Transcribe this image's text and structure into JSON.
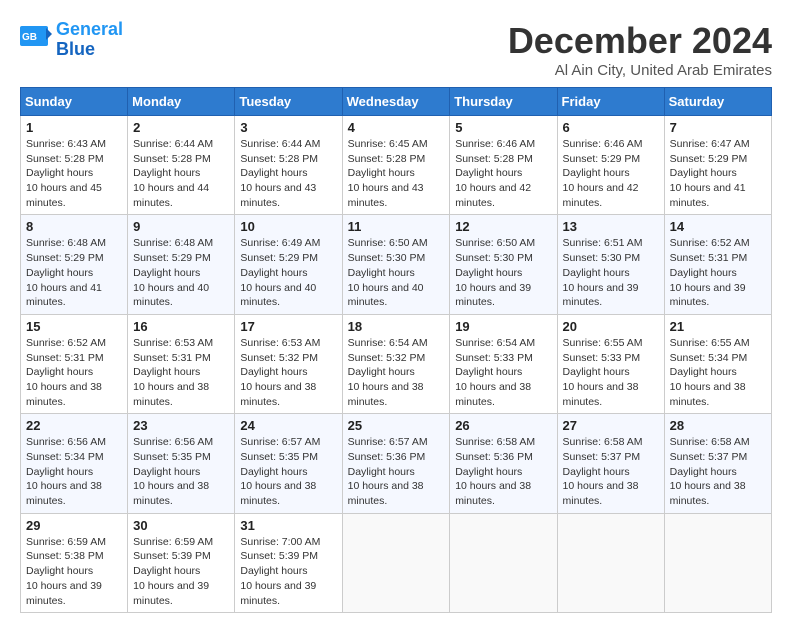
{
  "header": {
    "logo_line1": "General",
    "logo_line2": "Blue",
    "month_title": "December 2024",
    "location": "Al Ain City, United Arab Emirates"
  },
  "weekdays": [
    "Sunday",
    "Monday",
    "Tuesday",
    "Wednesday",
    "Thursday",
    "Friday",
    "Saturday"
  ],
  "weeks": [
    [
      {
        "day": "1",
        "sunrise": "6:43 AM",
        "sunset": "5:28 PM",
        "daylight": "10 hours and 45 minutes."
      },
      {
        "day": "2",
        "sunrise": "6:44 AM",
        "sunset": "5:28 PM",
        "daylight": "10 hours and 44 minutes."
      },
      {
        "day": "3",
        "sunrise": "6:44 AM",
        "sunset": "5:28 PM",
        "daylight": "10 hours and 43 minutes."
      },
      {
        "day": "4",
        "sunrise": "6:45 AM",
        "sunset": "5:28 PM",
        "daylight": "10 hours and 43 minutes."
      },
      {
        "day": "5",
        "sunrise": "6:46 AM",
        "sunset": "5:28 PM",
        "daylight": "10 hours and 42 minutes."
      },
      {
        "day": "6",
        "sunrise": "6:46 AM",
        "sunset": "5:29 PM",
        "daylight": "10 hours and 42 minutes."
      },
      {
        "day": "7",
        "sunrise": "6:47 AM",
        "sunset": "5:29 PM",
        "daylight": "10 hours and 41 minutes."
      }
    ],
    [
      {
        "day": "8",
        "sunrise": "6:48 AM",
        "sunset": "5:29 PM",
        "daylight": "10 hours and 41 minutes."
      },
      {
        "day": "9",
        "sunrise": "6:48 AM",
        "sunset": "5:29 PM",
        "daylight": "10 hours and 40 minutes."
      },
      {
        "day": "10",
        "sunrise": "6:49 AM",
        "sunset": "5:29 PM",
        "daylight": "10 hours and 40 minutes."
      },
      {
        "day": "11",
        "sunrise": "6:50 AM",
        "sunset": "5:30 PM",
        "daylight": "10 hours and 40 minutes."
      },
      {
        "day": "12",
        "sunrise": "6:50 AM",
        "sunset": "5:30 PM",
        "daylight": "10 hours and 39 minutes."
      },
      {
        "day": "13",
        "sunrise": "6:51 AM",
        "sunset": "5:30 PM",
        "daylight": "10 hours and 39 minutes."
      },
      {
        "day": "14",
        "sunrise": "6:52 AM",
        "sunset": "5:31 PM",
        "daylight": "10 hours and 39 minutes."
      }
    ],
    [
      {
        "day": "15",
        "sunrise": "6:52 AM",
        "sunset": "5:31 PM",
        "daylight": "10 hours and 38 minutes."
      },
      {
        "day": "16",
        "sunrise": "6:53 AM",
        "sunset": "5:31 PM",
        "daylight": "10 hours and 38 minutes."
      },
      {
        "day": "17",
        "sunrise": "6:53 AM",
        "sunset": "5:32 PM",
        "daylight": "10 hours and 38 minutes."
      },
      {
        "day": "18",
        "sunrise": "6:54 AM",
        "sunset": "5:32 PM",
        "daylight": "10 hours and 38 minutes."
      },
      {
        "day": "19",
        "sunrise": "6:54 AM",
        "sunset": "5:33 PM",
        "daylight": "10 hours and 38 minutes."
      },
      {
        "day": "20",
        "sunrise": "6:55 AM",
        "sunset": "5:33 PM",
        "daylight": "10 hours and 38 minutes."
      },
      {
        "day": "21",
        "sunrise": "6:55 AM",
        "sunset": "5:34 PM",
        "daylight": "10 hours and 38 minutes."
      }
    ],
    [
      {
        "day": "22",
        "sunrise": "6:56 AM",
        "sunset": "5:34 PM",
        "daylight": "10 hours and 38 minutes."
      },
      {
        "day": "23",
        "sunrise": "6:56 AM",
        "sunset": "5:35 PM",
        "daylight": "10 hours and 38 minutes."
      },
      {
        "day": "24",
        "sunrise": "6:57 AM",
        "sunset": "5:35 PM",
        "daylight": "10 hours and 38 minutes."
      },
      {
        "day": "25",
        "sunrise": "6:57 AM",
        "sunset": "5:36 PM",
        "daylight": "10 hours and 38 minutes."
      },
      {
        "day": "26",
        "sunrise": "6:58 AM",
        "sunset": "5:36 PM",
        "daylight": "10 hours and 38 minutes."
      },
      {
        "day": "27",
        "sunrise": "6:58 AM",
        "sunset": "5:37 PM",
        "daylight": "10 hours and 38 minutes."
      },
      {
        "day": "28",
        "sunrise": "6:58 AM",
        "sunset": "5:37 PM",
        "daylight": "10 hours and 38 minutes."
      }
    ],
    [
      {
        "day": "29",
        "sunrise": "6:59 AM",
        "sunset": "5:38 PM",
        "daylight": "10 hours and 39 minutes."
      },
      {
        "day": "30",
        "sunrise": "6:59 AM",
        "sunset": "5:39 PM",
        "daylight": "10 hours and 39 minutes."
      },
      {
        "day": "31",
        "sunrise": "7:00 AM",
        "sunset": "5:39 PM",
        "daylight": "10 hours and 39 minutes."
      },
      null,
      null,
      null,
      null
    ]
  ],
  "labels": {
    "sunrise": "Sunrise:",
    "sunset": "Sunset:",
    "daylight": "Daylight hours"
  }
}
